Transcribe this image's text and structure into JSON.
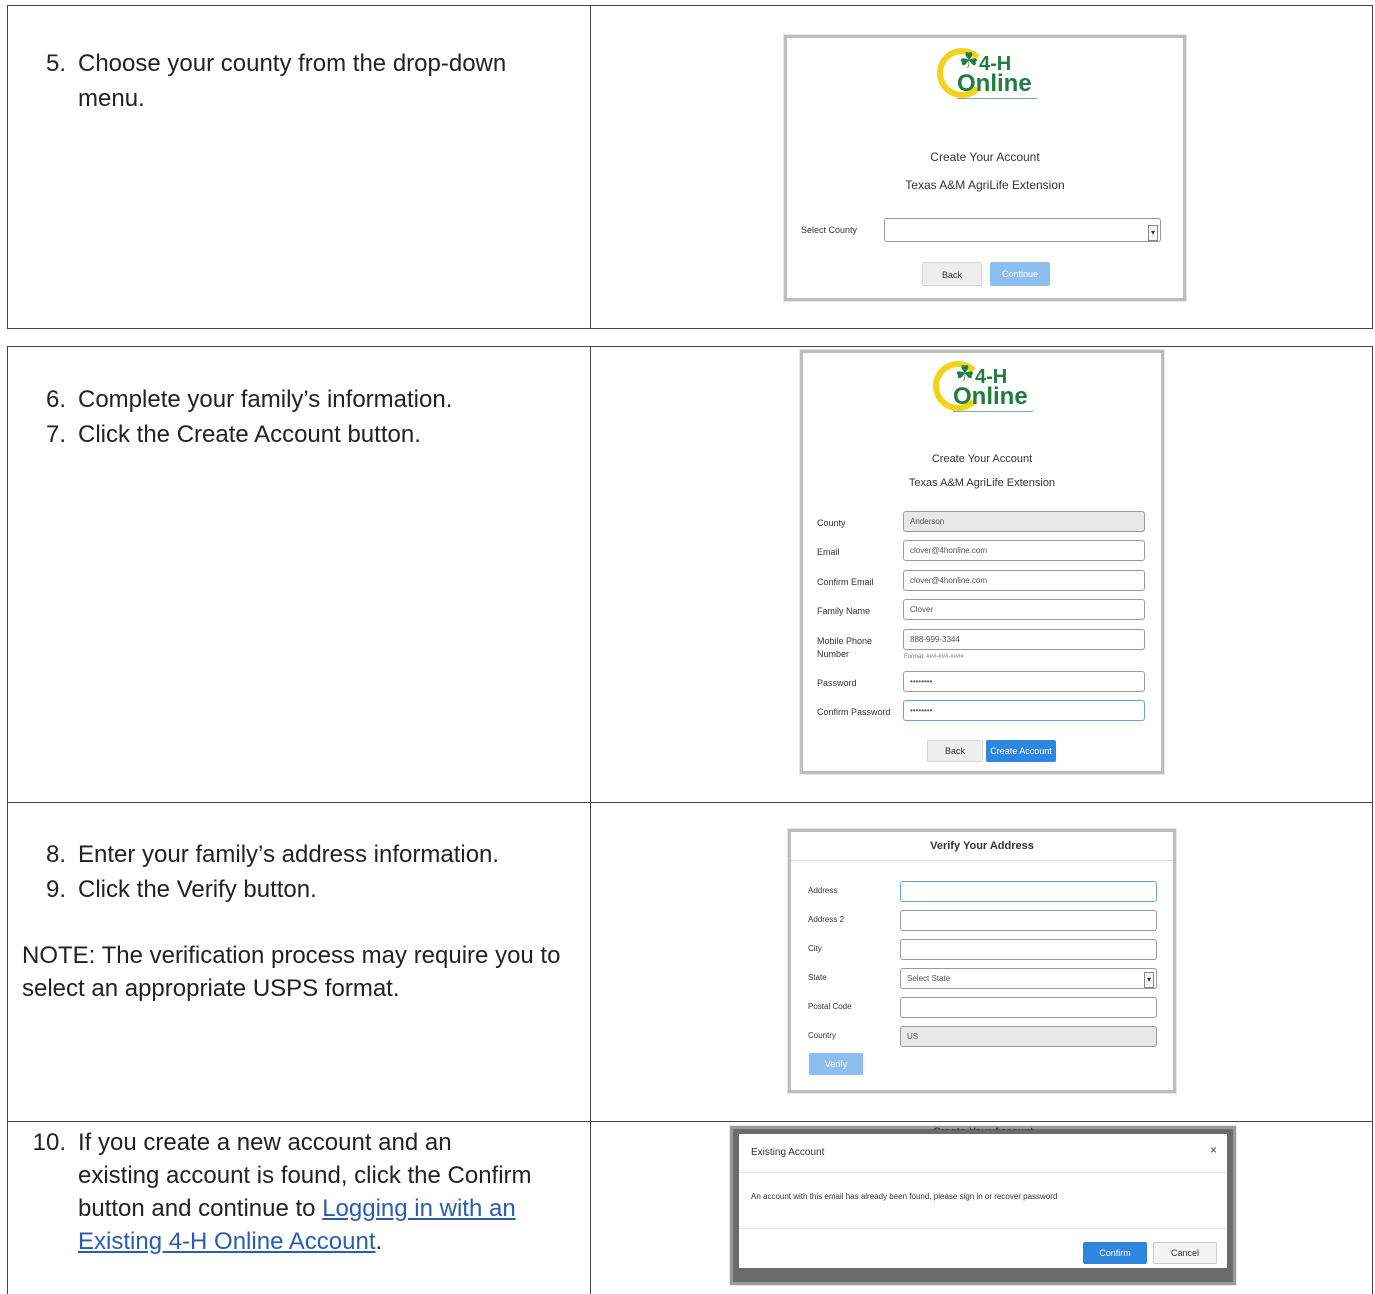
{
  "row1": {
    "step5_num": "5.",
    "step5_text": "Choose your county from the drop-down menu.",
    "shot": {
      "title": "Create Your Account",
      "org": "Texas A&M AgriLife Extension",
      "select_label": "Select County",
      "back": "Back",
      "continue": "Continue"
    }
  },
  "row2": {
    "step6_num": "6.",
    "step6_text": "Complete your family’s information.",
    "step7_num": "7.",
    "step7_text": "Click the Create Account button.",
    "shot": {
      "title": "Create Your Account",
      "org": "Texas A&M AgriLife Extension",
      "fields": [
        {
          "label": "County",
          "value": "Anderson"
        },
        {
          "label": "Email",
          "value": "clover@4honline.com"
        },
        {
          "label": "Confirm Email",
          "value": "clover@4honline.com"
        },
        {
          "label": "Family Name",
          "value": "Clover"
        },
        {
          "label": "Mobile Phone Number",
          "value": "888-999-3344"
        },
        {
          "label": "Password",
          "value": "••••••••"
        },
        {
          "label": "Confirm Password",
          "value": "••••••••"
        }
      ],
      "phone_hint": "Format: ###-###-####",
      "back": "Back",
      "create": "Create Account"
    }
  },
  "row3": {
    "step8_num": "8.",
    "step8_text": "Enter your family’s address information.",
    "step9_num": "9.",
    "step9_text": "Click the Verify button.",
    "note": "NOTE:  The verification process may require you to select an appropriate USPS format.",
    "shot": {
      "title": "Verify Your Address",
      "labels": [
        "Address",
        "Address 2",
        "City",
        "State",
        "Postal Code",
        "Country"
      ],
      "state_value": "Select State",
      "country_value": "US",
      "verify": "Verify"
    }
  },
  "row4": {
    "step10_num": "10.",
    "step10_text_a": "If you create a new account and an existing account is found, click the Confirm button and continue to ",
    "step10_link": "Logging in with an Existing 4-H Online Account",
    "step10_text_b": ".",
    "shot": {
      "behind_title": "Create Your Account",
      "modal_title": "Existing Account",
      "close": "×",
      "message": "An account with this email has already been found, please sign in or recover password",
      "confirm": "Confirm",
      "cancel": "Cancel"
    }
  },
  "logo": {
    "clover": "☘",
    "fourh": "4-H",
    "online": "Online"
  }
}
